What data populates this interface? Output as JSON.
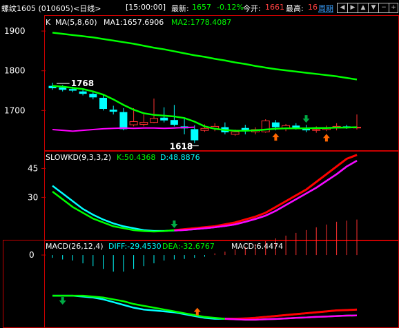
{
  "header": {
    "title": "螺纹1605 (010605)<日线>",
    "time": "[15:00:00]",
    "last_label": "最新:",
    "last_value": "1657",
    "change": "-0.12%",
    "open_label": "今开:",
    "open_value": "1661",
    "high_label": "最高:",
    "high_value": "16",
    "period_link": "周期",
    "nav_buttons": [
      "prev-icon",
      "next-icon",
      "up-icon",
      "down-icon",
      "zoom-out-icon",
      "zoom-in-icon"
    ]
  },
  "panels": {
    "price": {
      "indicator": "K",
      "ma_label": "MA(5,8,60)",
      "ma1": "MA1:1657.6906",
      "ma2": "MA2:1778.4087",
      "ticks": [
        "1900",
        "1800",
        "1700"
      ],
      "high_marker": "1768",
      "low_marker": "1618"
    },
    "kd": {
      "label": "SLOWKD(9,3,3,2)",
      "k": "K:50.4368",
      "d": "D:48.8876",
      "ticks": [
        "45",
        "30"
      ]
    },
    "macd": {
      "label": "MACD(26,12,4)",
      "diff": "DIFF:-29.4530",
      "dea": "DEA:-32.6767",
      "macd": "MACD:6.4474",
      "ticks": [
        "0"
      ]
    }
  },
  "colors": {
    "up": "#ff3232",
    "down": "#00ffff",
    "ma_green": "#00ff00",
    "ma_white": "#ffffff",
    "k_line": "#ff0000",
    "d_line": "#ff00ff",
    "axis": "#c80000",
    "label_cyan": "#00ffff"
  },
  "chart_data": [
    {
      "type": "candlestick",
      "title": "螺纹1605 日线",
      "ylim": [
        1600,
        1940
      ],
      "candles": [
        [
          1762,
          1770,
          1752,
          1756
        ],
        [
          1758,
          1764,
          1748,
          1752
        ],
        [
          1754,
          1760,
          1746,
          1750
        ],
        [
          1748,
          1756,
          1738,
          1742
        ],
        [
          1742,
          1748,
          1728,
          1733
        ],
        [
          1732,
          1740,
          1700,
          1704
        ],
        [
          1702,
          1712,
          1690,
          1697
        ],
        [
          1696,
          1706,
          1650,
          1653
        ],
        [
          1664,
          1706,
          1660,
          1672
        ],
        [
          1665,
          1690,
          1660,
          1670
        ],
        [
          1670,
          1730,
          1668,
          1680
        ],
        [
          1682,
          1708,
          1670,
          1675
        ],
        [
          1676,
          1714,
          1660,
          1664
        ],
        [
          1660,
          1680,
          1640,
          1655
        ],
        [
          1653,
          1663,
          1618,
          1625
        ],
        [
          1650,
          1665,
          1646,
          1655
        ],
        [
          1655,
          1668,
          1648,
          1660
        ],
        [
          1658,
          1670,
          1640,
          1645
        ],
        [
          1640,
          1652,
          1636,
          1646
        ],
        [
          1656,
          1664,
          1640,
          1648
        ],
        [
          1646,
          1658,
          1640,
          1652
        ],
        [
          1646,
          1678,
          1644,
          1674
        ],
        [
          1670,
          1676,
          1650,
          1658
        ],
        [
          1654,
          1666,
          1648,
          1662
        ],
        [
          1662,
          1668,
          1652,
          1655
        ],
        [
          1655,
          1664,
          1645,
          1650
        ],
        [
          1650,
          1660,
          1644,
          1652
        ],
        [
          1652,
          1662,
          1648,
          1656
        ],
        [
          1656,
          1668,
          1650,
          1660
        ],
        [
          1660,
          1664,
          1654,
          1658
        ],
        [
          1656,
          1690,
          1652,
          1658
        ]
      ],
      "ma60": [
        1896,
        1893,
        1890,
        1887,
        1884,
        1880,
        1876,
        1872,
        1868,
        1863,
        1858,
        1854,
        1849,
        1844,
        1839,
        1835,
        1830,
        1826,
        1821,
        1817,
        1812,
        1808,
        1804,
        1801,
        1798,
        1795,
        1792,
        1789,
        1786,
        1782,
        1778
      ],
      "ma5": [
        1760,
        1758,
        1755,
        1752,
        1746,
        1738,
        1724,
        1708,
        1695,
        1688,
        1686,
        1685,
        1684,
        1679,
        1667,
        1655,
        1652,
        1650,
        1648,
        1650,
        1652,
        1654,
        1655,
        1656,
        1655,
        1656,
        1656,
        1655,
        1656,
        1657,
        1658
      ],
      "ma8": [
        1762,
        1760,
        1757,
        1754,
        1748,
        1740,
        1728,
        1714,
        1702,
        1693,
        1689,
        1687,
        1685,
        1681,
        1672,
        1660,
        1654,
        1651,
        1649,
        1649,
        1650,
        1652,
        1654,
        1655,
        1655,
        1655,
        1656,
        1656,
        1657,
        1657,
        1658
      ],
      "up_arrows": [
        22,
        27
      ],
      "down_arrows": [
        25
      ]
    },
    {
      "type": "line",
      "title": "SLOWKD(9,3,3,2)",
      "ylim": [
        8,
        53
      ],
      "series": [
        {
          "name": "K",
          "values": [
            33,
            29,
            25,
            22,
            19,
            17,
            15,
            14,
            13,
            12.5,
            12.3,
            12.5,
            13,
            13.5,
            14,
            14.5,
            15,
            16,
            17,
            18.5,
            20,
            22,
            25,
            28,
            31,
            34,
            38,
            42,
            46,
            50,
            52
          ]
        },
        {
          "name": "D",
          "values": [
            36,
            32,
            28,
            24,
            21,
            18.5,
            16.5,
            15,
            14,
            13,
            12.6,
            12.6,
            12.8,
            13.1,
            13.5,
            14,
            14.5,
            15.2,
            16,
            17.3,
            18.8,
            20.5,
            23,
            26,
            29,
            32,
            35,
            38.5,
            42,
            46,
            49
          ]
        }
      ],
      "down_arrows": [
        12
      ]
    },
    {
      "type": "line",
      "title": "MACD(26,12,4)",
      "ylim": [
        -38,
        6
      ],
      "series": [
        {
          "name": "DIFF",
          "values": [
            -22,
            -22,
            -22,
            -22.5,
            -23,
            -24,
            -25.5,
            -27,
            -28.5,
            -29.5,
            -30,
            -30.5,
            -31,
            -32,
            -33,
            -34,
            -34.5,
            -34.5,
            -34.5,
            -34.3,
            -34,
            -33.5,
            -33,
            -32.5,
            -32,
            -31.5,
            -31,
            -30.5,
            -30,
            -29.8,
            -29.5
          ]
        },
        {
          "name": "DEA",
          "values": [
            -22,
            -22,
            -22,
            -22,
            -22.5,
            -23,
            -24,
            -25,
            -26.5,
            -27.5,
            -28.5,
            -29.5,
            -30.5,
            -31.5,
            -32.5,
            -33.5,
            -34,
            -34.5,
            -34.8,
            -35,
            -35,
            -34.8,
            -34.6,
            -34.3,
            -34,
            -33.8,
            -33.5,
            -33.3,
            -33,
            -32.8,
            -32.7
          ]
        }
      ],
      "macd_bars": [
        -0.5,
        -0.8,
        -1,
        -1.5,
        -2,
        -2.5,
        -3,
        -3,
        -2.5,
        -2,
        -1.5,
        -1,
        -0.8,
        -0.7,
        -0.5,
        -0.3,
        0.3,
        0.6,
        1,
        1.5,
        2,
        2.5,
        3,
        3.5,
        4,
        4.5,
        5,
        5.5,
        6,
        6.2,
        6.4
      ],
      "down_arrows": [
        1
      ],
      "up_arrows": [
        14
      ]
    }
  ]
}
